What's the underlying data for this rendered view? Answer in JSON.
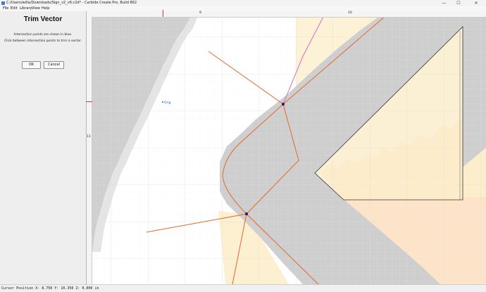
{
  "window": {
    "title": "C:/Users/willa/Downloads/Sign_v2_v6.c2d* - Carbide Create Pro, Build 862",
    "minimize": "—",
    "maximize": "☐",
    "close": "✕"
  },
  "menu": [
    "File",
    "Edit",
    "Library",
    "View",
    "Help"
  ],
  "panel": {
    "heading": "Trim Vector",
    "line1": "Intersection points are shown in blue.",
    "line2": "Click between intersection points to trim a vector.",
    "ok_label": "OK",
    "cancel_label": "Cancel"
  },
  "rulers": {
    "top_labels": [
      "9",
      "10"
    ],
    "left_labels": [
      "11"
    ]
  },
  "canvas": {
    "origin_label": "Orig"
  },
  "colors": {
    "grid": "#d9d9d9",
    "pixel_gray": "#cdcdcd",
    "yellow_shade": "#fdeecb",
    "orange_vector": "#e06a2a",
    "magenta_vector": "#d36fbd",
    "intersection": "#1a1a6e",
    "ruler_marker": "#d33a2a"
  },
  "status": {
    "text": "Cursor Position X: 8.750 Y: 10.350 Z: 0.000 in"
  }
}
